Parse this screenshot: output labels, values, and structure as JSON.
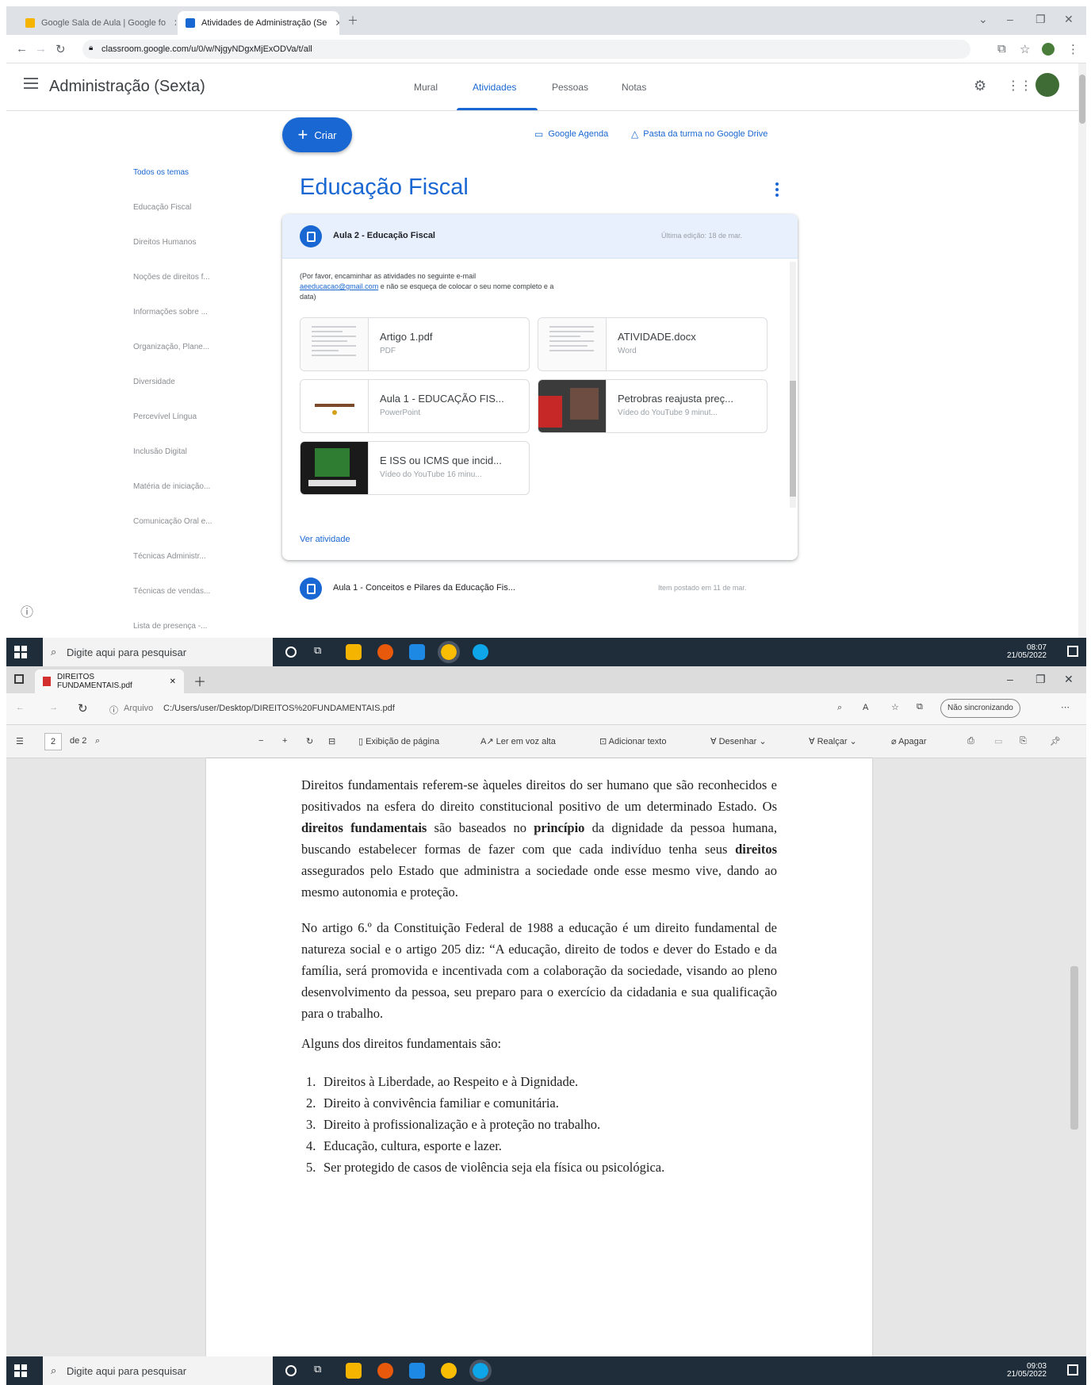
{
  "top_window": {
    "tabs": [
      {
        "label": "Google Sala de Aula | Google fo",
        "active": false
      },
      {
        "label": "Atividades de Administração (Se",
        "active": true
      }
    ],
    "url": "classroom.google.com/u/0/w/NjgyNDgxMjExODVa/t/all",
    "app": {
      "class_name": "Administração (Sexta)",
      "nav_tabs": [
        "Mural",
        "Atividades",
        "Pessoas",
        "Notas"
      ],
      "active_nav": "Atividades",
      "create_label": "Criar",
      "calendar_link": "Google Agenda",
      "drive_link": "Pasta da turma no Google Drive",
      "topics": [
        "Todos os temas",
        "Educação Fiscal",
        "Direitos Humanos",
        "Noções de direitos f...",
        "Informações sobre ...",
        "Organização, Plane...",
        "Diversidade",
        "Percevível Língua",
        "Inclusão Digital",
        "Matéria de iniciação...",
        "Comunicação Oral e...",
        "Técnicas Administr...",
        "Técnicas de vendas...",
        "Lista de presença -..."
      ],
      "section_title": "Educação Fiscal",
      "assignment": {
        "title": "Aula 2 - Educação Fiscal",
        "meta": "Última edição: 18 de mar.",
        "instructions_1": "(Por favor, encaminhar as atividades no seguinte e-mail",
        "instructions_email": "aeeducacao@gmail.com",
        "instructions_2": "e não se esqueça de colocar o seu nome completo e a data)",
        "attachments": [
          {
            "title": "Artigo 1.pdf",
            "type": "PDF"
          },
          {
            "title": "ATIVIDADE.docx",
            "type": "Word"
          },
          {
            "title": "Aula 1 - EDUCAÇÃO FIS...",
            "type": "PowerPoint"
          },
          {
            "title": "Petrobras reajusta preç...",
            "type": "Vídeo do YouTube   9 minut..."
          },
          {
            "title": "E ISS ou ICMS que incid...",
            "type": "Vídeo do YouTube   16 minu..."
          }
        ],
        "view_label": "Ver atividade"
      },
      "next_assignment": {
        "title": "Aula 1 - Conceitos e Pilares da Educação Fis...",
        "meta": "Item postado em 11 de mar."
      }
    },
    "taskbar": {
      "search_placeholder": "Digite aqui para pesquisar",
      "time": "08:07",
      "date": "21/05/2022"
    }
  },
  "bottom_window": {
    "tab_label": "DIREITOS FUNDAMENTAIS.pdf",
    "address_prefix": "Arquivo",
    "path": "C:/Users/user/Desktop/DIREITOS%20FUNDAMENTAIS.pdf",
    "not_syncing": "Não sincronizando",
    "toolbar": {
      "page_num": "2",
      "page_total": "de 2",
      "page_view": "Exibição de página",
      "read_aloud": "Ler em voz alta",
      "add_text": "Adicionar texto",
      "draw": "Desenhar",
      "highlight": "Realçar",
      "erase": "Apagar"
    },
    "pdf": {
      "para1_a": "Direitos fundamentais referem-se àqueles direitos do ser humano que são reconhecidos e positivados na esfera do direito constitucional positivo de um determinado Estado. Os ",
      "para1_b1": "direitos fundamentais",
      "para1_c": " são baseados no ",
      "para1_b2": "princípio",
      "para1_d": " da dignidade da pessoa humana, buscando estabelecer formas de fazer com que cada indivíduo tenha seus ",
      "para1_b3": "direitos",
      "para1_e": " assegurados pelo Estado que administra a sociedade onde esse mesmo vive, dando ao mesmo autonomia e proteção.",
      "para2": "No artigo 6.º da Constituição Federal de 1988 a educação é um direito fundamental de natureza social e o artigo 205 diz: “A educação, direito de todos e dever do Estado e da família, será promovida e incentivada com a colaboração da sociedade, visando ao pleno desenvolvimento da pessoa, seu preparo para o exercício da cidadania e sua qualificação para o trabalho.",
      "para3": "Alguns dos direitos fundamentais são:",
      "list": [
        "Direitos à Liberdade, ao Respeito e à Dignidade.",
        "Direito à convivência familiar e comunitária.",
        "Direito à profissionalização e à proteção no trabalho.",
        "Educação, cultura, esporte e lazer.",
        "Ser protegido de casos de violência seja ela física ou psicológica."
      ]
    },
    "taskbar": {
      "search_placeholder": "Digite aqui para pesquisar",
      "time": "09:03",
      "date": "21/05/2022"
    }
  },
  "colors": {
    "accent": "#1967d2",
    "taskbar": "#1f2d3a"
  }
}
